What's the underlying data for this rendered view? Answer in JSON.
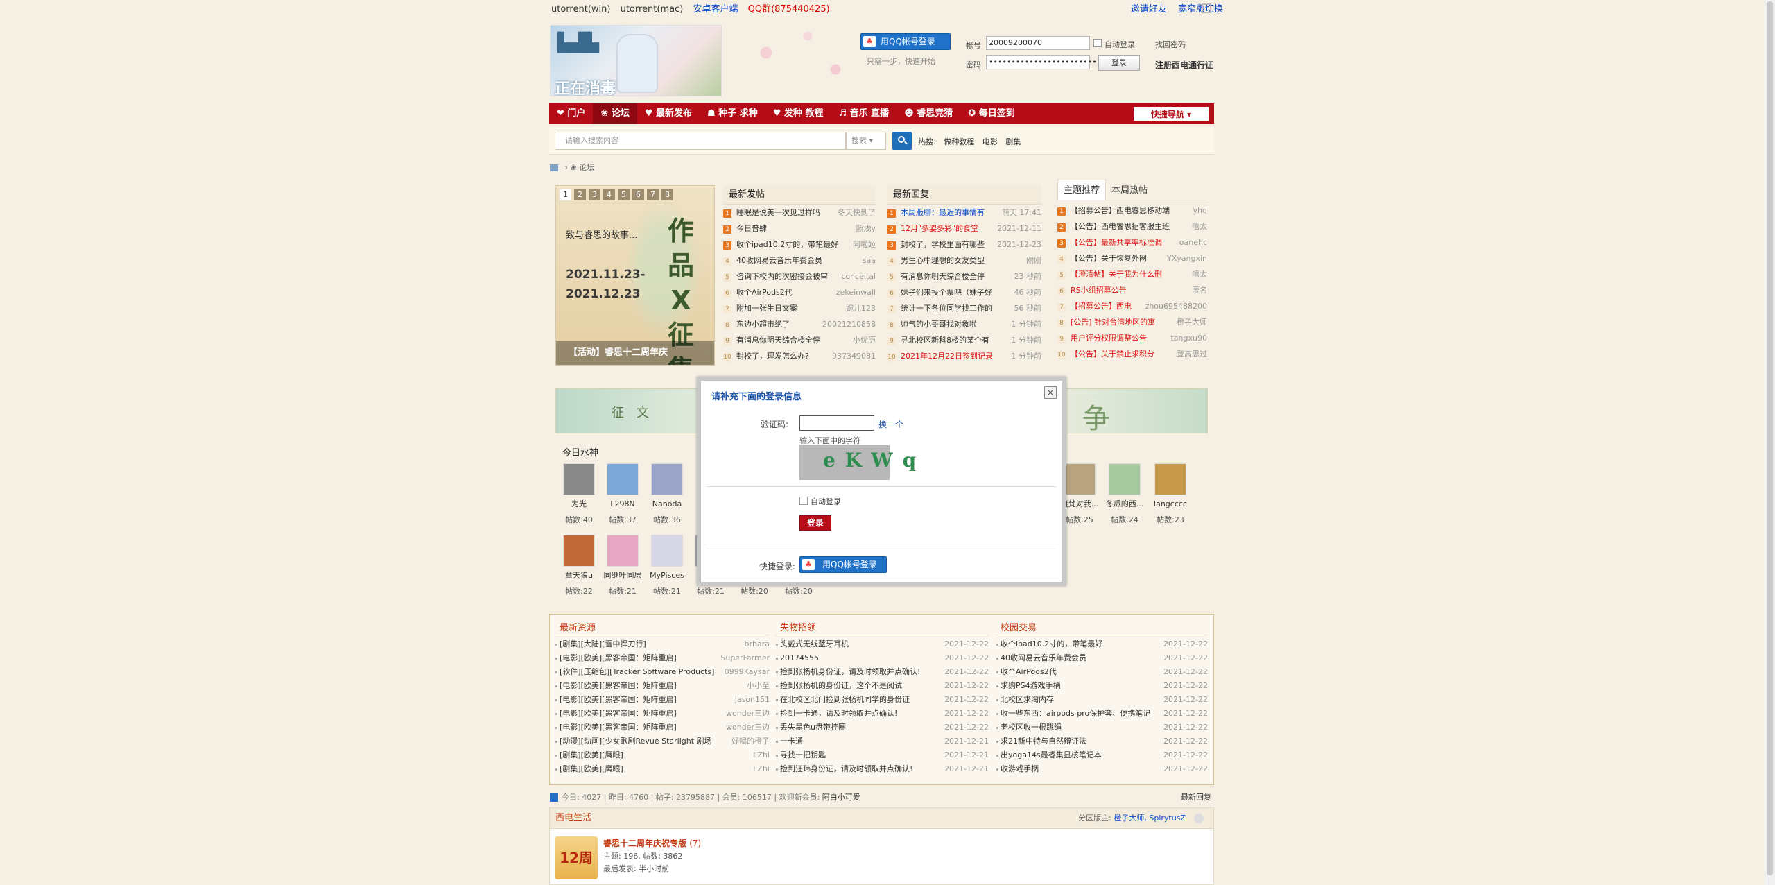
{
  "topbar": {
    "links": [
      "utorrent(win)",
      "utorrent(mac)",
      "安卓客户端",
      "QQ群(875440425)"
    ],
    "right": [
      "邀请好友",
      "宽窄版切换"
    ]
  },
  "header": {
    "logo_text": "正在消毒",
    "qq_login": "用QQ帐号登录",
    "qq_hint": "只需一步，快速开始",
    "user_label": "帐号",
    "user_value": "20009200070",
    "pass_label": "密码",
    "pass_value": "••••••••••••••••••••••••",
    "auto_login": "自动登录",
    "find_password": "找回密码",
    "login_btn": "登录",
    "register": "注册西电通行证"
  },
  "nav": {
    "items": [
      "❤ 门户",
      "❀ 论坛",
      "♥ 最新发布",
      "☗ 种子 求种",
      "♥ 发种 教程",
      "♬ 音乐 直播",
      "☻ 睿思竞猜",
      "✪ 每日签到"
    ],
    "quick": "快捷导航 ▾"
  },
  "search": {
    "placeholder": "请输入搜索内容",
    "select": "搜索 ▾",
    "hot_label": "热搜:",
    "hot": [
      "做种教程",
      "电影",
      "剧集"
    ]
  },
  "breadcrumb": {
    "path": "›  ❀ 论坛"
  },
  "slide": {
    "pages": [
      "1",
      "2",
      "3",
      "4",
      "5",
      "6",
      "7",
      "8"
    ],
    "line1": "致与睿思的故事...",
    "date1": "2021.11.23-",
    "date2": "2021.12.23",
    "big": "作品 X 征集",
    "caption": "【活动】睿思十二周年庆"
  },
  "new_posts": {
    "title": "最新发帖",
    "rows": [
      {
        "n": "1",
        "t": "睡眠是说美一次见过样吗",
        "m": "冬天快到了"
      },
      {
        "n": "2",
        "t": "今日普肆",
        "m": "照浅y"
      },
      {
        "n": "3",
        "t": "收个ipad10.2寸的，带笔最好",
        "m": "阿啦姬"
      },
      {
        "n": "4",
        "t": "40收网易云音乐年费会员",
        "m": "saa"
      },
      {
        "n": "5",
        "t": "咨询下校内的次密接会被审",
        "m": "conceital"
      },
      {
        "n": "6",
        "t": "收个AirPods2代",
        "m": "zekeinwall"
      },
      {
        "n": "7",
        "t": "附加一张生日文案",
        "m": "婉儿123"
      },
      {
        "n": "8",
        "t": "东边小超市绝了",
        "m": "20021210858"
      },
      {
        "n": "9",
        "t": "有消息你明天综合楼全停",
        "m": "小优历"
      },
      {
        "n": "10",
        "t": "封校了，理发怎么办?",
        "m": "937349081"
      }
    ]
  },
  "new_replies": {
    "title": "最新回复",
    "rows": [
      {
        "n": "1",
        "t": "本周版聊：最近的事情有",
        "m": "前天 17:41",
        "c": "blu"
      },
      {
        "n": "2",
        "t": "12月\"多姿多彩\"的食堂",
        "m": "2021-12-11",
        "c": "red"
      },
      {
        "n": "3",
        "t": "封校了，学校里面有哪些",
        "m": "2021-12-23",
        "c": ""
      },
      {
        "n": "4",
        "t": "男生心中理想的女友类型",
        "m": "刚刚",
        "c": ""
      },
      {
        "n": "5",
        "t": "有消息你明天综合楼全停",
        "m": "23 秒前",
        "c": ""
      },
      {
        "n": "6",
        "t": "妹子们来投个票吧（妹子好",
        "m": "46 秒前",
        "c": ""
      },
      {
        "n": "7",
        "t": "统计一下各位同学找工作的",
        "m": "56 秒前",
        "c": ""
      },
      {
        "n": "8",
        "t": "帅气的小哥哥找对象啦",
        "m": "1 分钟前",
        "c": ""
      },
      {
        "n": "9",
        "t": "寻北校区新科8楼的某个有",
        "m": "1 分钟前",
        "c": ""
      },
      {
        "n": "10",
        "t": "2021年12月22日签到记录",
        "m": "1 分钟前",
        "c": "red"
      }
    ]
  },
  "topics": {
    "tabs": [
      "主题推荐",
      "本周热帖"
    ],
    "rows": [
      {
        "n": "1",
        "t": "【招募公告】西电睿思移动端",
        "m": "yhq",
        "c": ""
      },
      {
        "n": "2",
        "t": "【公告】西电睿思招客服主班",
        "m": "嘻太",
        "c": ""
      },
      {
        "n": "3",
        "t": "【公告】最新共享率标准调",
        "m": "oanehc",
        "c": "red"
      },
      {
        "n": "4",
        "t": "【公告】关于恢复外网",
        "m": "YXyangxin",
        "c": ""
      },
      {
        "n": "5",
        "t": "【澄清帖】关于我为什么删",
        "m": "嘻太",
        "c": "red"
      },
      {
        "n": "6",
        "t": "RS小组招募公告",
        "m": "匿名",
        "c": "red"
      },
      {
        "n": "7",
        "t": "【招募公告】西电",
        "m": "zhou695488200",
        "c": "red"
      },
      {
        "n": "8",
        "t": "[公告] 针对台湾地区的寓",
        "m": "橙子大师",
        "c": "red"
      },
      {
        "n": "9",
        "t": "用户评分权限调整公告",
        "m": "tangxu90",
        "c": "red"
      },
      {
        "n": "10",
        "t": "【公告】关于禁止求积分",
        "m": "登高思过",
        "c": "red"
      }
    ]
  },
  "water": {
    "title": "今日水神",
    "row1": [
      {
        "name": "为光",
        "count": "帖数:40"
      },
      {
        "name": "L298N",
        "count": "帖数:37"
      },
      {
        "name": "Nanoda",
        "count": "帖数:36"
      },
      {
        "name": "渡梵对我...",
        "count": "帖数:25"
      },
      {
        "name": "冬瓜的西...",
        "count": "帖数:24"
      },
      {
        "name": "langcccc",
        "count": "帖数:23"
      }
    ],
    "row2": [
      {
        "name": "童天狼u",
        "count": "帖数:22"
      },
      {
        "name": "同继叶同层",
        "count": "帖数:21"
      },
      {
        "name": "MyPisces",
        "count": "帖数:21"
      },
      {
        "name": "",
        "count": "帖数:21"
      },
      {
        "name": "",
        "count": "帖数:20"
      },
      {
        "name": "",
        "count": "帖数:20"
      }
    ]
  },
  "resources": {
    "title": "最新资源",
    "rows": [
      {
        "t": "[剧集][大陆][雪中悍刀行]",
        "m": "brbara"
      },
      {
        "t": "[电影][欧美][黑客帝国：矩阵重启]",
        "m": "SuperFarmer"
      },
      {
        "t": "[软件][压缩包][Tracker Software Products]",
        "m": "0999Kaysar"
      },
      {
        "t": "[电影][欧美][黑客帝国：矩阵重启]",
        "m": "小小至"
      },
      {
        "t": "[电影][欧美][黑客帝国：矩阵重启]",
        "m": "jason151"
      },
      {
        "t": "[电影][欧美][黑客帝国：矩阵重启]",
        "m": "wonder三边"
      },
      {
        "t": "[电影][欧美][黑客帝国：矩阵重启]",
        "m": "wonder三边"
      },
      {
        "t": "[动漫][动画][少女歌剧Revue Starlight 剧场",
        "m": "好喝的橙子"
      },
      {
        "t": "[剧集][欧美][鹰眼]",
        "m": "LZhi"
      },
      {
        "t": "[剧集][欧美][鹰眼]",
        "m": "LZhi"
      }
    ]
  },
  "lost": {
    "title": "失物招领",
    "rows": [
      {
        "t": "头戴式无线蓝牙耳机",
        "m": "2021-12-22"
      },
      {
        "t": "20174555",
        "m": "2021-12-22"
      },
      {
        "t": "捡到张杨机身份证，请及时领取并点确认!",
        "m": "2021-12-22"
      },
      {
        "t": "捡到张杨机的身份证，这个不是阅试",
        "m": "2021-12-22"
      },
      {
        "t": "在北校区北门捡到张杨机同学的身份证",
        "m": "2021-12-22"
      },
      {
        "t": "捡到一卡通，请及时领取并点确认!",
        "m": "2021-12-22"
      },
      {
        "t": "丢失黑色u盘带挂圈",
        "m": "2021-12-22"
      },
      {
        "t": "一卡通",
        "m": "2021-12-21"
      },
      {
        "t": "寻找一把钥匙",
        "m": "2021-12-21"
      },
      {
        "t": "捡到汪玮身份证，请及时领取并点确认!",
        "m": "2021-12-21"
      }
    ]
  },
  "trade": {
    "title": "校园交易",
    "rows": [
      {
        "t": "收个ipad10.2寸的，带笔最好",
        "m": "2021-12-22"
      },
      {
        "t": "40收网易云音乐年费会员",
        "m": "2021-12-22"
      },
      {
        "t": "收个AirPods2代",
        "m": "2021-12-22"
      },
      {
        "t": "求购PS4游戏手柄",
        "m": "2021-12-22"
      },
      {
        "t": "北校区求淘内存",
        "m": "2021-12-22"
      },
      {
        "t": "收一些东西：airpods pro保护套、便携笔记",
        "m": "2021-12-22"
      },
      {
        "t": "老校区收一根跳绳",
        "m": "2021-12-22"
      },
      {
        "t": "求21新中特与自然辩证法",
        "m": "2021-12-22"
      },
      {
        "t": "出yoga14s最睿集显核笔记本",
        "m": "2021-12-22"
      },
      {
        "t": "收游戏手柄",
        "m": "2021-12-22"
      }
    ]
  },
  "stats": {
    "text": "今日: 4027  |  昨日: 4760  |  帖子: 23795887  |  会员: 106517  |  欢迎新会员: ",
    "newest_member": "阿白小可爱",
    "latest_reply": "最新回复"
  },
  "forum": {
    "title": "西电生活",
    "mods_label": "分区版主: ",
    "mods": "橙子大师, SpirytusZ",
    "icon_text": "12周年",
    "board": "睿思十二周年庆祝专版",
    "board_count": "(7)",
    "line1": "主题: 196, 帖数: 3862",
    "line2": "最后发表: 半小时前"
  },
  "modal": {
    "title": "请补充下面的登录信息",
    "close": "×",
    "captcha_label": "验证码:",
    "change": "换一个",
    "hint": "输入下面中的字符",
    "captcha_chars": "eKWq",
    "auto_login": "自动登录",
    "login": "登录",
    "quick_label": "快捷登录:",
    "qq_login": "用QQ帐号登录"
  }
}
